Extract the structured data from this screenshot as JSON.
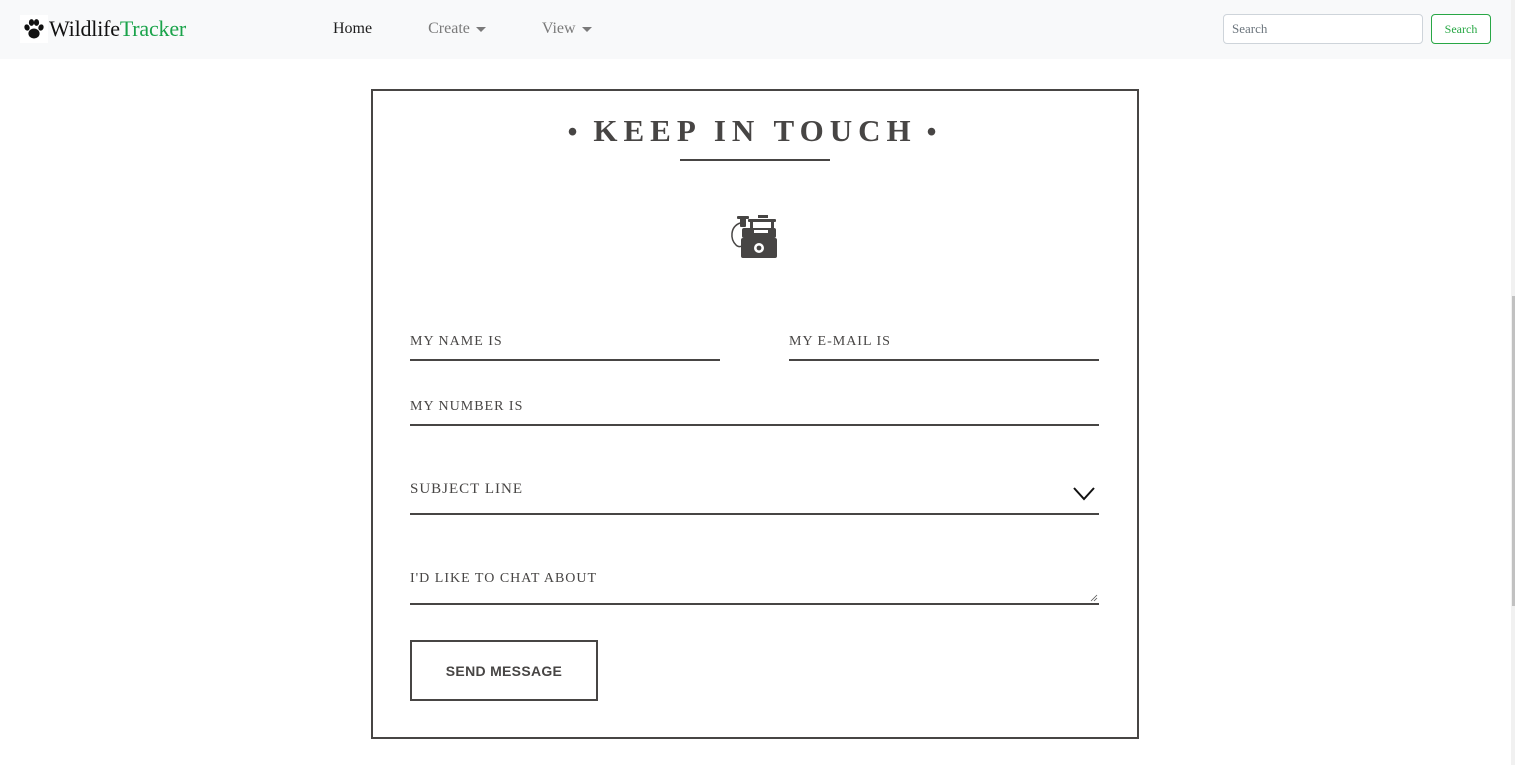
{
  "navbar": {
    "brand_part1": "Wildlife",
    "brand_part2": "Tracker",
    "brand_color": "#1aa34a",
    "links": [
      {
        "label": "Home",
        "active": true
      },
      {
        "label": "Create",
        "dropdown": true
      },
      {
        "label": "View",
        "dropdown": true
      }
    ],
    "search_placeholder": "Search",
    "search_button": "Search"
  },
  "form": {
    "title": "KEEP IN TOUCH",
    "title_bullet": "•",
    "icon": "telephone-icon",
    "name_placeholder": "MY NAME IS",
    "email_placeholder": "MY E-MAIL IS",
    "number_placeholder": "MY NUMBER IS",
    "subject_label": "SUBJECT LINE",
    "message_placeholder": "I'D LIKE TO CHAT ABOUT",
    "send_button": "SEND MESSAGE"
  },
  "colors": {
    "text": "#474544",
    "navbar_bg": "#f8f9fa",
    "success": "#28a745"
  }
}
